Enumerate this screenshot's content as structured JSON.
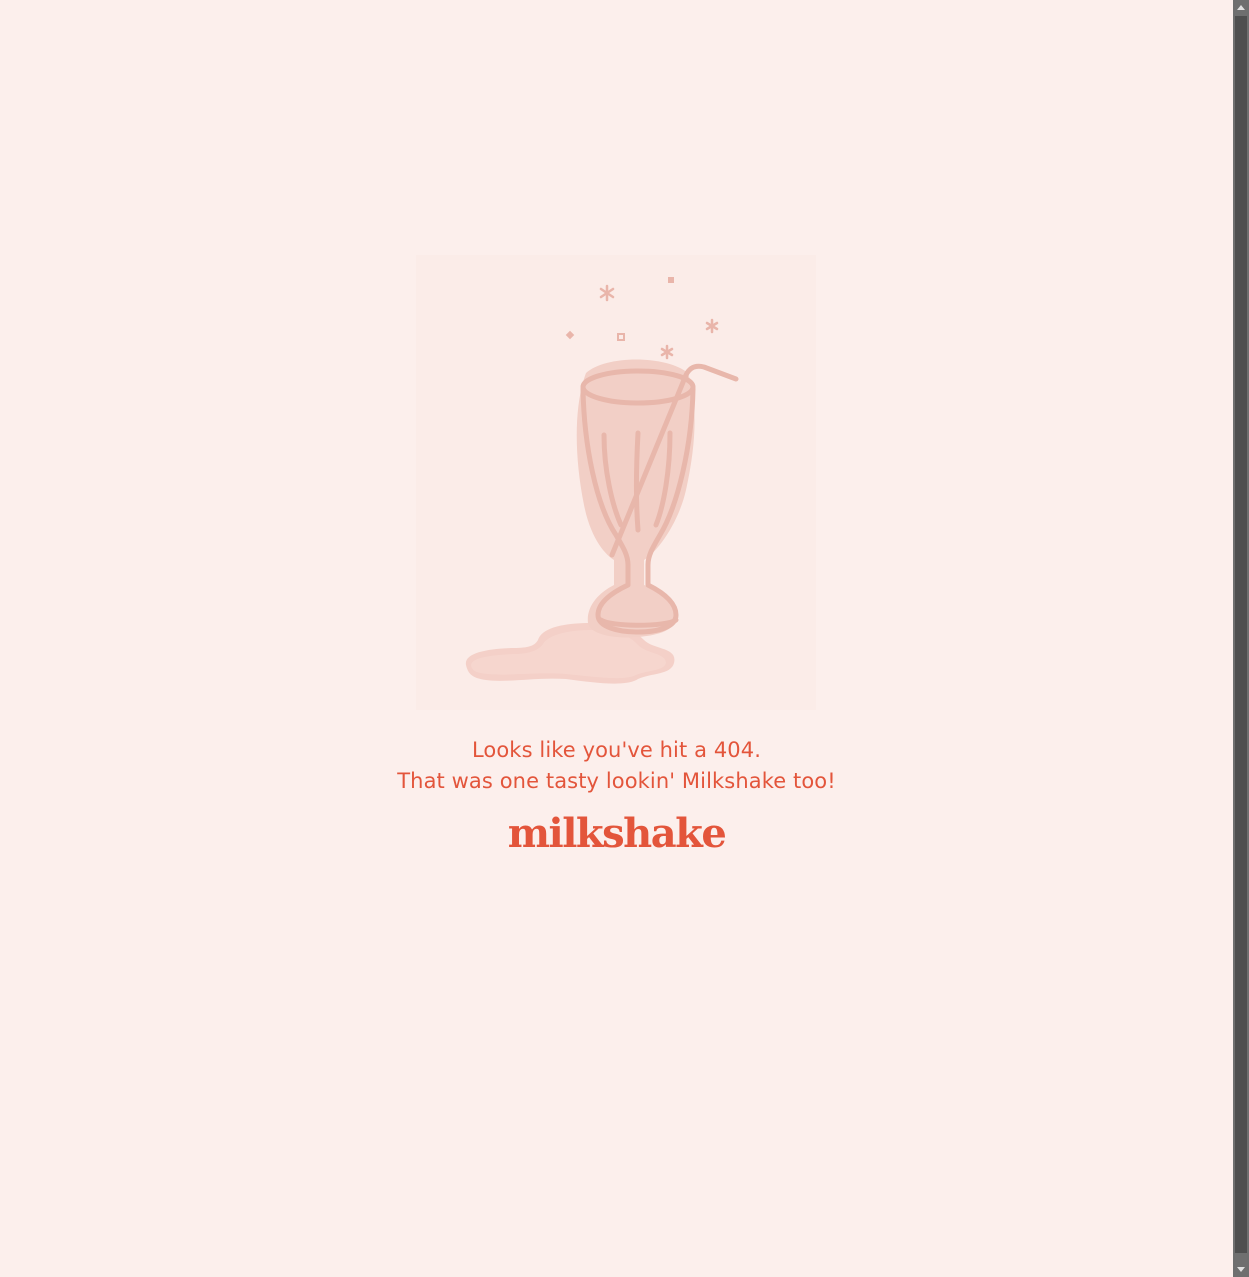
{
  "page": {
    "background_color": "#fcefec",
    "accent_color": "#e3553b",
    "illustration_color": "#edc3b9",
    "illustration": "spilled-milkshake-glass-illustration",
    "message_line1": "Looks like you've hit a 404.",
    "message_line2": "That was one tasty lookin' Milkshake too!",
    "logo_text": "milkshake"
  },
  "scrollbar": {
    "up_icon": "scroll-up-arrow-icon",
    "down_icon": "scroll-down-arrow-icon"
  }
}
